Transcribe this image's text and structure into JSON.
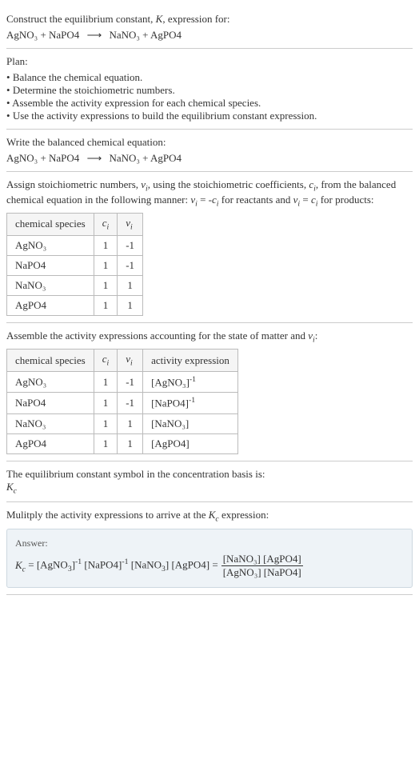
{
  "intro": {
    "line1": "Construct the equilibrium constant, K, expression for:",
    "equation_lhs": "AgNO₃ + NaPO4",
    "equation_rhs": "NaNO₃ + AgPO4"
  },
  "plan": {
    "heading": "Plan:",
    "items": [
      "Balance the chemical equation.",
      "Determine the stoichiometric numbers.",
      "Assemble the activity expression for each chemical species.",
      "Use the activity expressions to build the equilibrium constant expression."
    ]
  },
  "balanced": {
    "heading": "Write the balanced chemical equation:",
    "equation_lhs": "AgNO₃ + NaPO4",
    "equation_rhs": "NaNO₃ + AgPO4"
  },
  "stoich": {
    "heading": "Assign stoichiometric numbers, νᵢ, using the stoichiometric coefficients, cᵢ, from the balanced chemical equation in the following manner: νᵢ = -cᵢ for reactants and νᵢ = cᵢ for products:",
    "table": {
      "headers": [
        "chemical species",
        "cᵢ",
        "νᵢ"
      ],
      "rows": [
        [
          "AgNO₃",
          "1",
          "-1"
        ],
        [
          "NaPO4",
          "1",
          "-1"
        ],
        [
          "NaNO₃",
          "1",
          "1"
        ],
        [
          "AgPO4",
          "1",
          "1"
        ]
      ]
    }
  },
  "activity": {
    "heading": "Assemble the activity expressions accounting for the state of matter and νᵢ:",
    "table": {
      "headers": [
        "chemical species",
        "cᵢ",
        "νᵢ",
        "activity expression"
      ],
      "rows": [
        {
          "species": "AgNO₃",
          "c": "1",
          "v": "-1",
          "expr_base": "[AgNO₃]",
          "expr_sup": "-1"
        },
        {
          "species": "NaPO4",
          "c": "1",
          "v": "-1",
          "expr_base": "[NaPO4]",
          "expr_sup": "-1"
        },
        {
          "species": "NaNO₃",
          "c": "1",
          "v": "1",
          "expr_base": "[NaNO₃]",
          "expr_sup": ""
        },
        {
          "species": "AgPO4",
          "c": "1",
          "v": "1",
          "expr_base": "[AgPO4]",
          "expr_sup": ""
        }
      ]
    }
  },
  "symbol": {
    "heading": "The equilibrium constant symbol in the concentration basis is:",
    "value": "K_c"
  },
  "multiply": {
    "heading": "Mulitply the activity expressions to arrive at the K_c expression:"
  },
  "answer": {
    "label": "Answer:",
    "lhs": "K_c = [AgNO₃]⁻¹ [NaPO4]⁻¹ [NaNO₃] [AgPO4] =",
    "num": "[NaNO₃] [AgPO4]",
    "den": "[AgNO₃] [NaPO4]"
  }
}
